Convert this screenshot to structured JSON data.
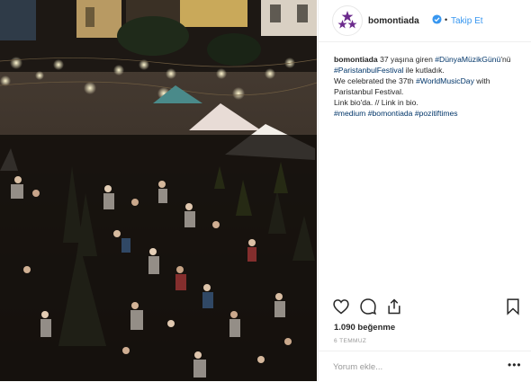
{
  "header": {
    "username": "bomontiada",
    "separator": "•",
    "follow_label": "Takip Et",
    "avatar_icon": "three-stars-logo-icon",
    "verified_icon": "verified-badge-icon",
    "accent_color": "#3897f0",
    "logo_color": "#6b2a8c"
  },
  "caption": {
    "username": "bomontiada",
    "text_1": "37 yaşına giren",
    "tag_1": "#DünyaMüzikGünü",
    "text_2": "'nü",
    "tag_2": "#ParistanbulFestival",
    "text_3": "ile kutladık.",
    "text_4": "We celebrated the 37th",
    "tag_3": "#WorldMusicDay",
    "text_5": "with Paristanbul Festival.",
    "text_6": "Link bio'da. // Link in bio.",
    "tag_4": "#medium",
    "tag_5": "#bomontiada",
    "tag_6": "#pozitiftimes"
  },
  "actions": {
    "like_icon": "heart-icon",
    "comment_icon": "comment-bubble-icon",
    "share_icon": "share-icon",
    "save_icon": "bookmark-icon"
  },
  "likes": "1.090 beğenme",
  "date": "6 TEMMUZ",
  "comment": {
    "placeholder": "Yorum ekle...",
    "more": "•••"
  },
  "photo": {
    "description_icon": "concert-crowd-photo"
  }
}
